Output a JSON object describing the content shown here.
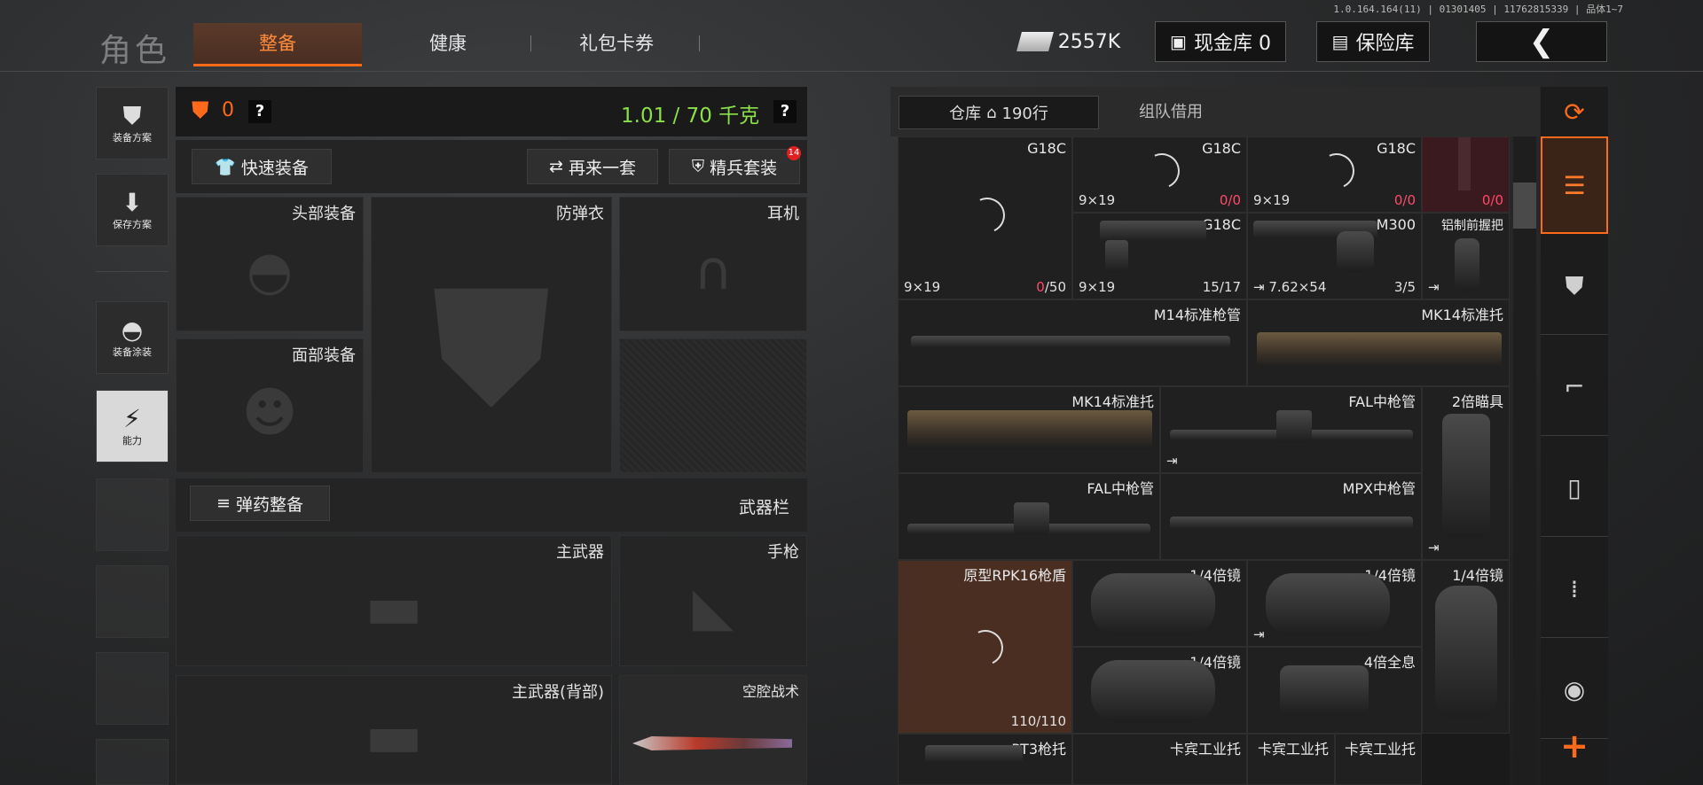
{
  "version": "1.0.164.164(11) | 01301405 | 11762815339 | 品体1~7",
  "header": {
    "title": "角色",
    "tabs": [
      {
        "label": "整备",
        "active": true
      },
      {
        "label": "健康"
      },
      {
        "label": "礼包卡券"
      }
    ],
    "currency": "2557K",
    "cash_vault": "现金库 0",
    "safe": "保险库"
  },
  "left_menu": [
    {
      "label": "装备方案",
      "icon": "vest-icon"
    },
    {
      "label": "保存方案",
      "icon": "download-icon"
    },
    {
      "label": "装备涂装",
      "icon": "helmet-icon"
    },
    {
      "label": "能力",
      "icon": "lightning-icon",
      "active": true
    }
  ],
  "equip": {
    "armor_count": "0",
    "weight": "1.01 / 70 千克",
    "quick_equip": "快速装备",
    "reroll": "再来一套",
    "elite_kit": "精兵套装",
    "elite_badge": "14",
    "slots": {
      "head": "头部装备",
      "vest": "防弹衣",
      "ear": "耳机",
      "face": "面部装备"
    },
    "ammo_btn": "弹药整备",
    "weapon_bar": "武器栏",
    "weapons": {
      "primary": "主武器",
      "pistol": "手枪",
      "primary_back": "主武器(背部)",
      "melee": "空腔战术"
    }
  },
  "stash": {
    "tab_warehouse": "仓库",
    "rows": "190行",
    "tab_team": "组队借用",
    "items": [
      {
        "name": "G18C",
        "cal": "9×19",
        "ammo": "0",
        "cap": "50"
      },
      {
        "name": "G18C",
        "cal": "9×19",
        "ammo": "0",
        "cap": "0"
      },
      {
        "name": "G18C",
        "cal": "9×19",
        "ammo": "0",
        "cap": "0"
      },
      {
        "name": "",
        "cal": "",
        "ammo": "0",
        "cap": "0"
      },
      {
        "name": "G18C",
        "cal": "9×19",
        "count": "15/17"
      },
      {
        "name": "M300",
        "cal": "7.62×54",
        "count": "3/5"
      },
      {
        "name": "铝制前握把"
      },
      {
        "name": "M14标准枪管"
      },
      {
        "name": "MK14标准托"
      },
      {
        "name": "MK14标准托"
      },
      {
        "name": "FAL中枪管"
      },
      {
        "name": "2倍瞄具"
      },
      {
        "name": "FAL中枪管"
      },
      {
        "name": "MPX中枪管"
      },
      {
        "name": "原型RPK16枪盾",
        "count": "110/110"
      },
      {
        "name": "1/4倍镜"
      },
      {
        "name": "1/4倍镜"
      },
      {
        "name": "1/4倍镜"
      },
      {
        "name": "1/4倍镜"
      },
      {
        "name": "4倍全息"
      },
      {
        "name": "PT3枪托"
      },
      {
        "name": "卡宾工业托"
      },
      {
        "name": "卡宾工业托"
      },
      {
        "name": "卡宾工业托"
      }
    ]
  },
  "categories": [
    "all-icon",
    "armor-icon",
    "rifle-icon",
    "magazine-icon",
    "ammo-icon",
    "scope-icon"
  ],
  "add_label": "+"
}
